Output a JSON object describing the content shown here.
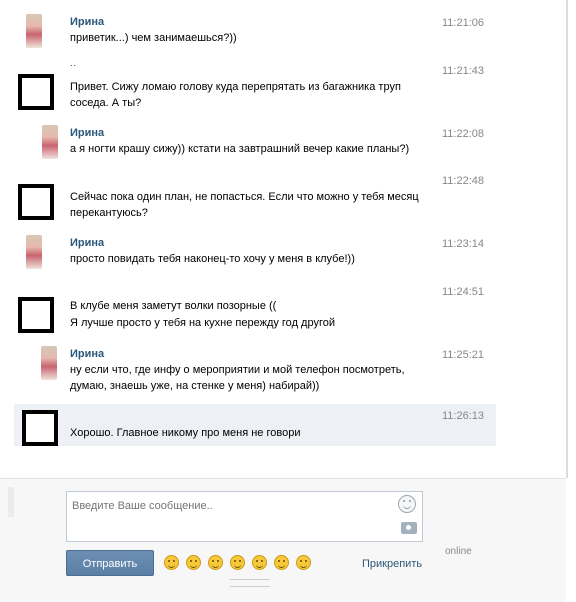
{
  "messages": [
    {
      "author": "Ирина",
      "lines": [
        "приветик...) чем занимаешься?))"
      ],
      "time": "11:21:06",
      "avatar": "photo"
    },
    {
      "author": "",
      "dots": "..",
      "lines": [
        "Привет. Сижу ломаю голову куда перепрятать из багажника труп",
        "соседа. А ты?"
      ],
      "time": "11:21:43",
      "avatar": "box"
    },
    {
      "author": "Ирина",
      "lines": [
        "а я ногти крашу сижу)) кстати на завтрашний вечер какие планы?)"
      ],
      "time": "11:22:08",
      "avatar": "photo"
    },
    {
      "author": "",
      "lines": [
        "Сейчас пока один план, не попасться. Если что можно у тебя месяц",
        "перекантуюсь?"
      ],
      "time": "11:22:48",
      "avatar": "box"
    },
    {
      "author": "Ирина",
      "lines": [
        "просто повидать тебя наконец-то хочу у меня в клубе!))"
      ],
      "time": "11:23:14",
      "avatar": "photo"
    },
    {
      "author": "",
      "lines": [
        "В клубе меня заметут волки позорные ((",
        "Я лучше просто у тебя на кухне пережду год другой"
      ],
      "time": "11:24:51",
      "avatar": "box"
    },
    {
      "author": "Ирина",
      "lines": [
        "ну если что, где инфу о мероприятии и мой телефон посмотреть,",
        "думаю, знаешь уже, на стенке у меня) набирай))"
      ],
      "time": "11:25:21",
      "avatar": "photo"
    },
    {
      "author": "",
      "lines": [
        "Хорошо. Главное никому про меня не говори"
      ],
      "time": "11:26:13",
      "avatar": "box"
    }
  ],
  "compose": {
    "placeholder": "Введите Ваше сообщение..",
    "send_label": "Отправить",
    "attach_label": "Прикрепить",
    "status": "online"
  },
  "icons": {
    "smile": "smile-icon",
    "camera": "camera-icon",
    "emojis": [
      "grin-emoji",
      "smile-emoji",
      "worried-emoji",
      "wink-emoji",
      "angel-emoji",
      "angry-emoji",
      "laugh-emoji"
    ]
  }
}
